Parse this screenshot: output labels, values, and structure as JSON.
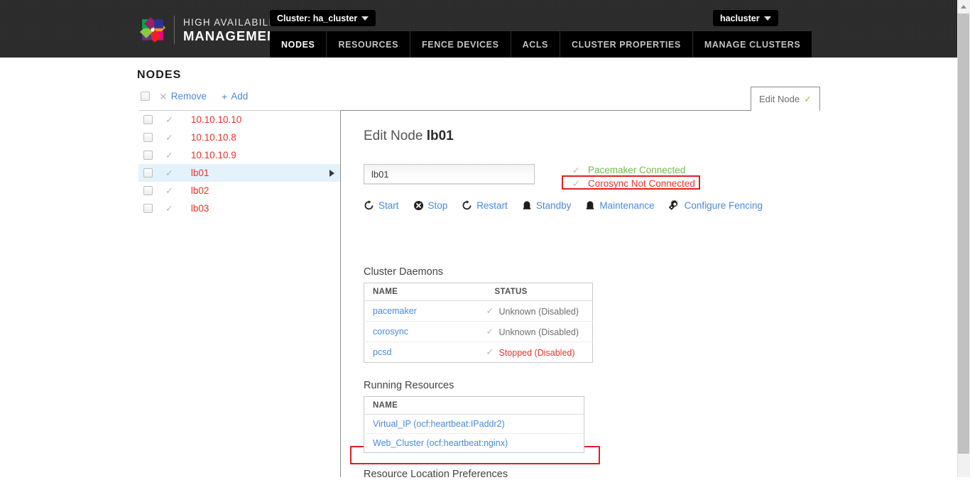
{
  "header": {
    "brand_line1": "HIGH AVAILABILITY",
    "brand_line2": "MANAGEMENT",
    "cluster_selector": "Cluster: ha_cluster",
    "user_selector": "hacluster",
    "nav": [
      {
        "label": "NODES",
        "active": true
      },
      {
        "label": "RESOURCES",
        "active": false
      },
      {
        "label": "FENCE DEVICES",
        "active": false
      },
      {
        "label": "ACLS",
        "active": false
      },
      {
        "label": "CLUSTER PROPERTIES",
        "active": false
      },
      {
        "label": "MANAGE CLUSTERS",
        "active": false
      }
    ]
  },
  "page": {
    "title": "NODES"
  },
  "toolbar": {
    "remove_label": "Remove",
    "add_label": "Add",
    "x_glyph": "✕",
    "plus_glyph": "+"
  },
  "node_list": {
    "check_glyph": "✓",
    "items": [
      {
        "label": "10.10.10.10",
        "selected": false
      },
      {
        "label": "10.10.10.8",
        "selected": false
      },
      {
        "label": "10.10.10.9",
        "selected": false
      },
      {
        "label": "lb01",
        "selected": true
      },
      {
        "label": "lb02",
        "selected": false
      },
      {
        "label": "lb03",
        "selected": false
      }
    ]
  },
  "edit_tab": {
    "label": "Edit Node",
    "check_glyph": "✓"
  },
  "edit_panel": {
    "heading_prefix": "Edit Node ",
    "heading_node": "lb01",
    "node_name_value": "lb01",
    "status": {
      "check_glyph": "✓",
      "pacemaker": "Pacemaker Connected",
      "corosync": "Corosync Not Connected"
    },
    "actions": [
      {
        "label": "Start",
        "icon": "restart-arrow-icon"
      },
      {
        "label": "Stop",
        "icon": "stop-circle-icon"
      },
      {
        "label": "Restart",
        "icon": "restart-arrow-icon"
      },
      {
        "label": "Standby",
        "icon": "standby-icon"
      },
      {
        "label": "Maintenance",
        "icon": "maintenance-icon"
      },
      {
        "label": "Configure Fencing",
        "icon": "gears-icon"
      }
    ],
    "daemons": {
      "title": "Cluster Daemons",
      "columns": [
        "NAME",
        "STATUS"
      ],
      "rows": [
        {
          "name": "pacemaker",
          "status": "Unknown (Disabled)",
          "highlight": false
        },
        {
          "name": "corosync",
          "status": "Unknown (Disabled)",
          "highlight": false
        },
        {
          "name": "pcsd",
          "status": "Stopped (Disabled)",
          "highlight": true
        }
      ]
    },
    "resources": {
      "title": "Running Resources",
      "columns": [
        "NAME"
      ],
      "rows": [
        {
          "name": "Virtual_IP (ocf:heartbeat:IPaddr2)"
        },
        {
          "name": "Web_Cluster (ocf:heartbeat:nginx)"
        }
      ]
    },
    "prefs_title": "Resource Location Preferences"
  },
  "colors": {
    "header_bg": "#2b2b2b",
    "nav_bg": "#000000",
    "link_blue": "#4a89dc",
    "node_red": "#e8342a",
    "status_green": "#7ab648",
    "alert_red": "#e02020",
    "selected_row": "#e3f2fb"
  }
}
